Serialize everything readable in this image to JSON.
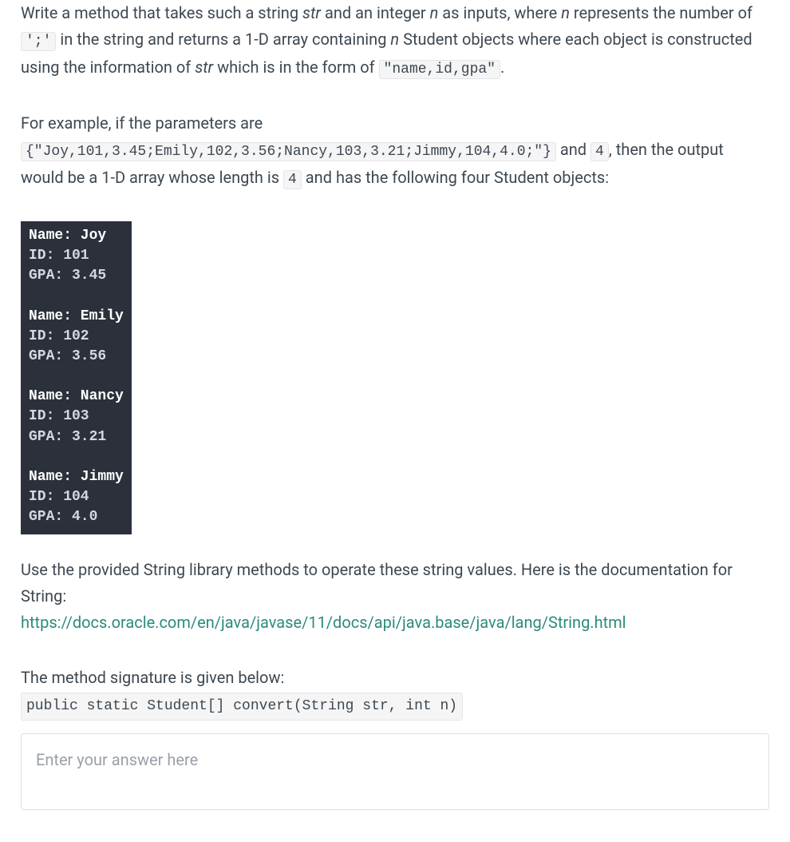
{
  "para1": {
    "t1": "Write a method that takes such a string ",
    "str": "str",
    "t2": " and an integer ",
    "n": "n",
    "t3": " as inputs, where ",
    "n2": "n",
    "t4": " represents the number of ",
    "semicolon_code": "';'",
    "t5": " in the string and returns a 1-D array containing ",
    "n3": "n",
    "t6": " Student objects where each object is constructed using the information of ",
    "str2": "str",
    "t7": " which is in the form of ",
    "format_code": "\"name,id,gpa\"",
    "t8": "."
  },
  "para2": {
    "t1": "For example, if the parameters are ",
    "example_input": "{\"Joy,101,3.45;Emily,102,3.56;Nancy,103,3.21;Jimmy,104,4.0;\"}",
    "t2": " and ",
    "four": "4",
    "t3": ", then the output would be a 1-D array whose length is ",
    "four2": "4",
    "t4": " and has the following four Student objects:"
  },
  "console": {
    "s1": {
      "name": "Name: Joy",
      "id": "ID: 101",
      "gpa": "GPA: 3.45"
    },
    "s2": {
      "name": "Name: Emily",
      "id": "ID: 102",
      "gpa": "GPA: 3.56"
    },
    "s3": {
      "name": "Name: Nancy",
      "id": "ID: 103",
      "gpa": "GPA: 3.21"
    },
    "s4": {
      "name": "Name: Jimmy",
      "id": "ID: 104",
      "gpa": "GPA: 4.0"
    }
  },
  "para3": {
    "t1": "Use the provided String library methods to operate these string values. Here is the documentation for String:",
    "link": "https://docs.oracle.com/en/java/javase/11/docs/api/java.base/java/lang/String.html"
  },
  "para4": {
    "t1": "The method signature is given below:",
    "sig": "public static Student[] convert(String str, int n)"
  },
  "answer_placeholder": "Enter your answer here"
}
